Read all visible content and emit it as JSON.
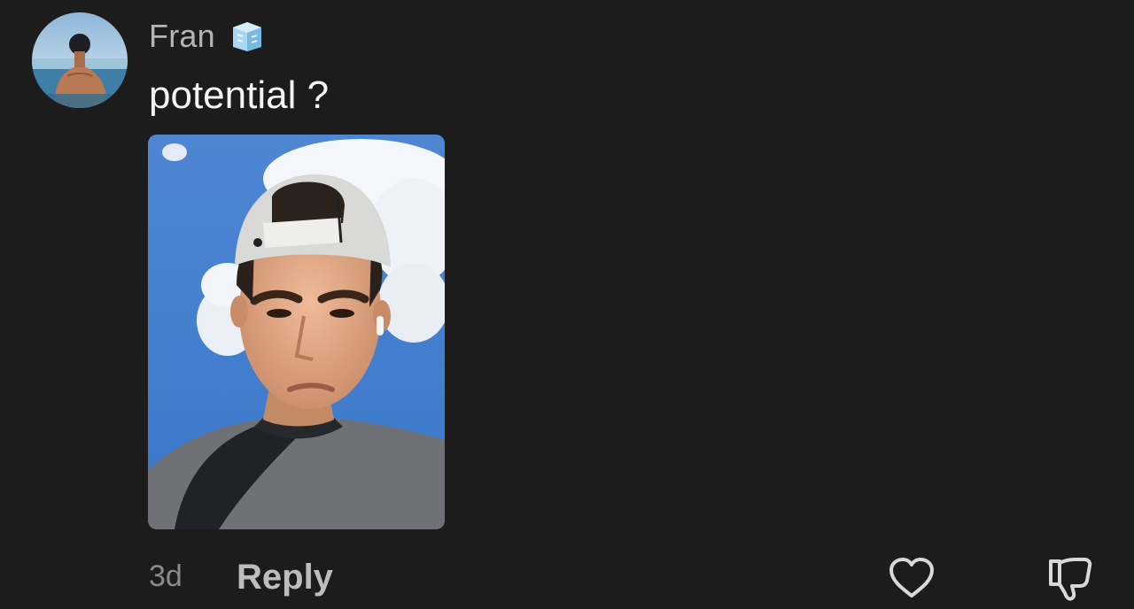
{
  "comment": {
    "username": "Fran",
    "badge_icon": "ice-cube-icon",
    "text": "potential ?",
    "timestamp": "3d",
    "reply_label": "Reply",
    "like_icon": "heart-icon",
    "dislike_icon": "thumbs-down-icon"
  },
  "colors": {
    "background": "#1c1c1c",
    "username": "#b5b5b5",
    "comment_text": "#f4f4f4",
    "timestamp": "#8a8a8a",
    "reply": "#bdbdbd",
    "icon_stroke": "#d9d9d9"
  }
}
